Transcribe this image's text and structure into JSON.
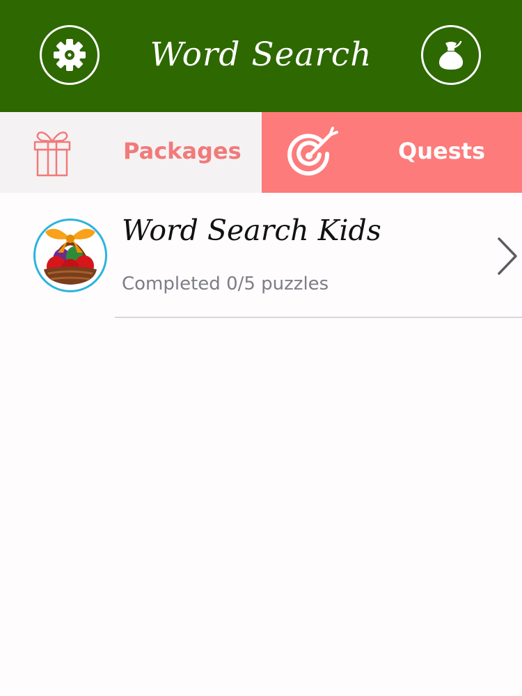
{
  "header": {
    "title": "Word Search",
    "settings_icon": "gear-icon",
    "coins_icon": "money-bag-icon",
    "background_color": "#2d6800"
  },
  "tabs": [
    {
      "label": "Packages",
      "icon": "gift-icon",
      "selected": false
    },
    {
      "label": "Quests",
      "icon": "target-icon",
      "selected": true
    }
  ],
  "packages": [
    {
      "title": "Word Search Kids",
      "progress_text": "Completed 0/5 puzzles",
      "completed": 0,
      "total": 5,
      "icon": "easter-basket-icon",
      "chevron_icon": "chevron-right-icon"
    }
  ],
  "colors": {
    "accent": "#fd7b7b",
    "accent_text": "#f17a7a",
    "avatar_border": "#2cb3df"
  }
}
